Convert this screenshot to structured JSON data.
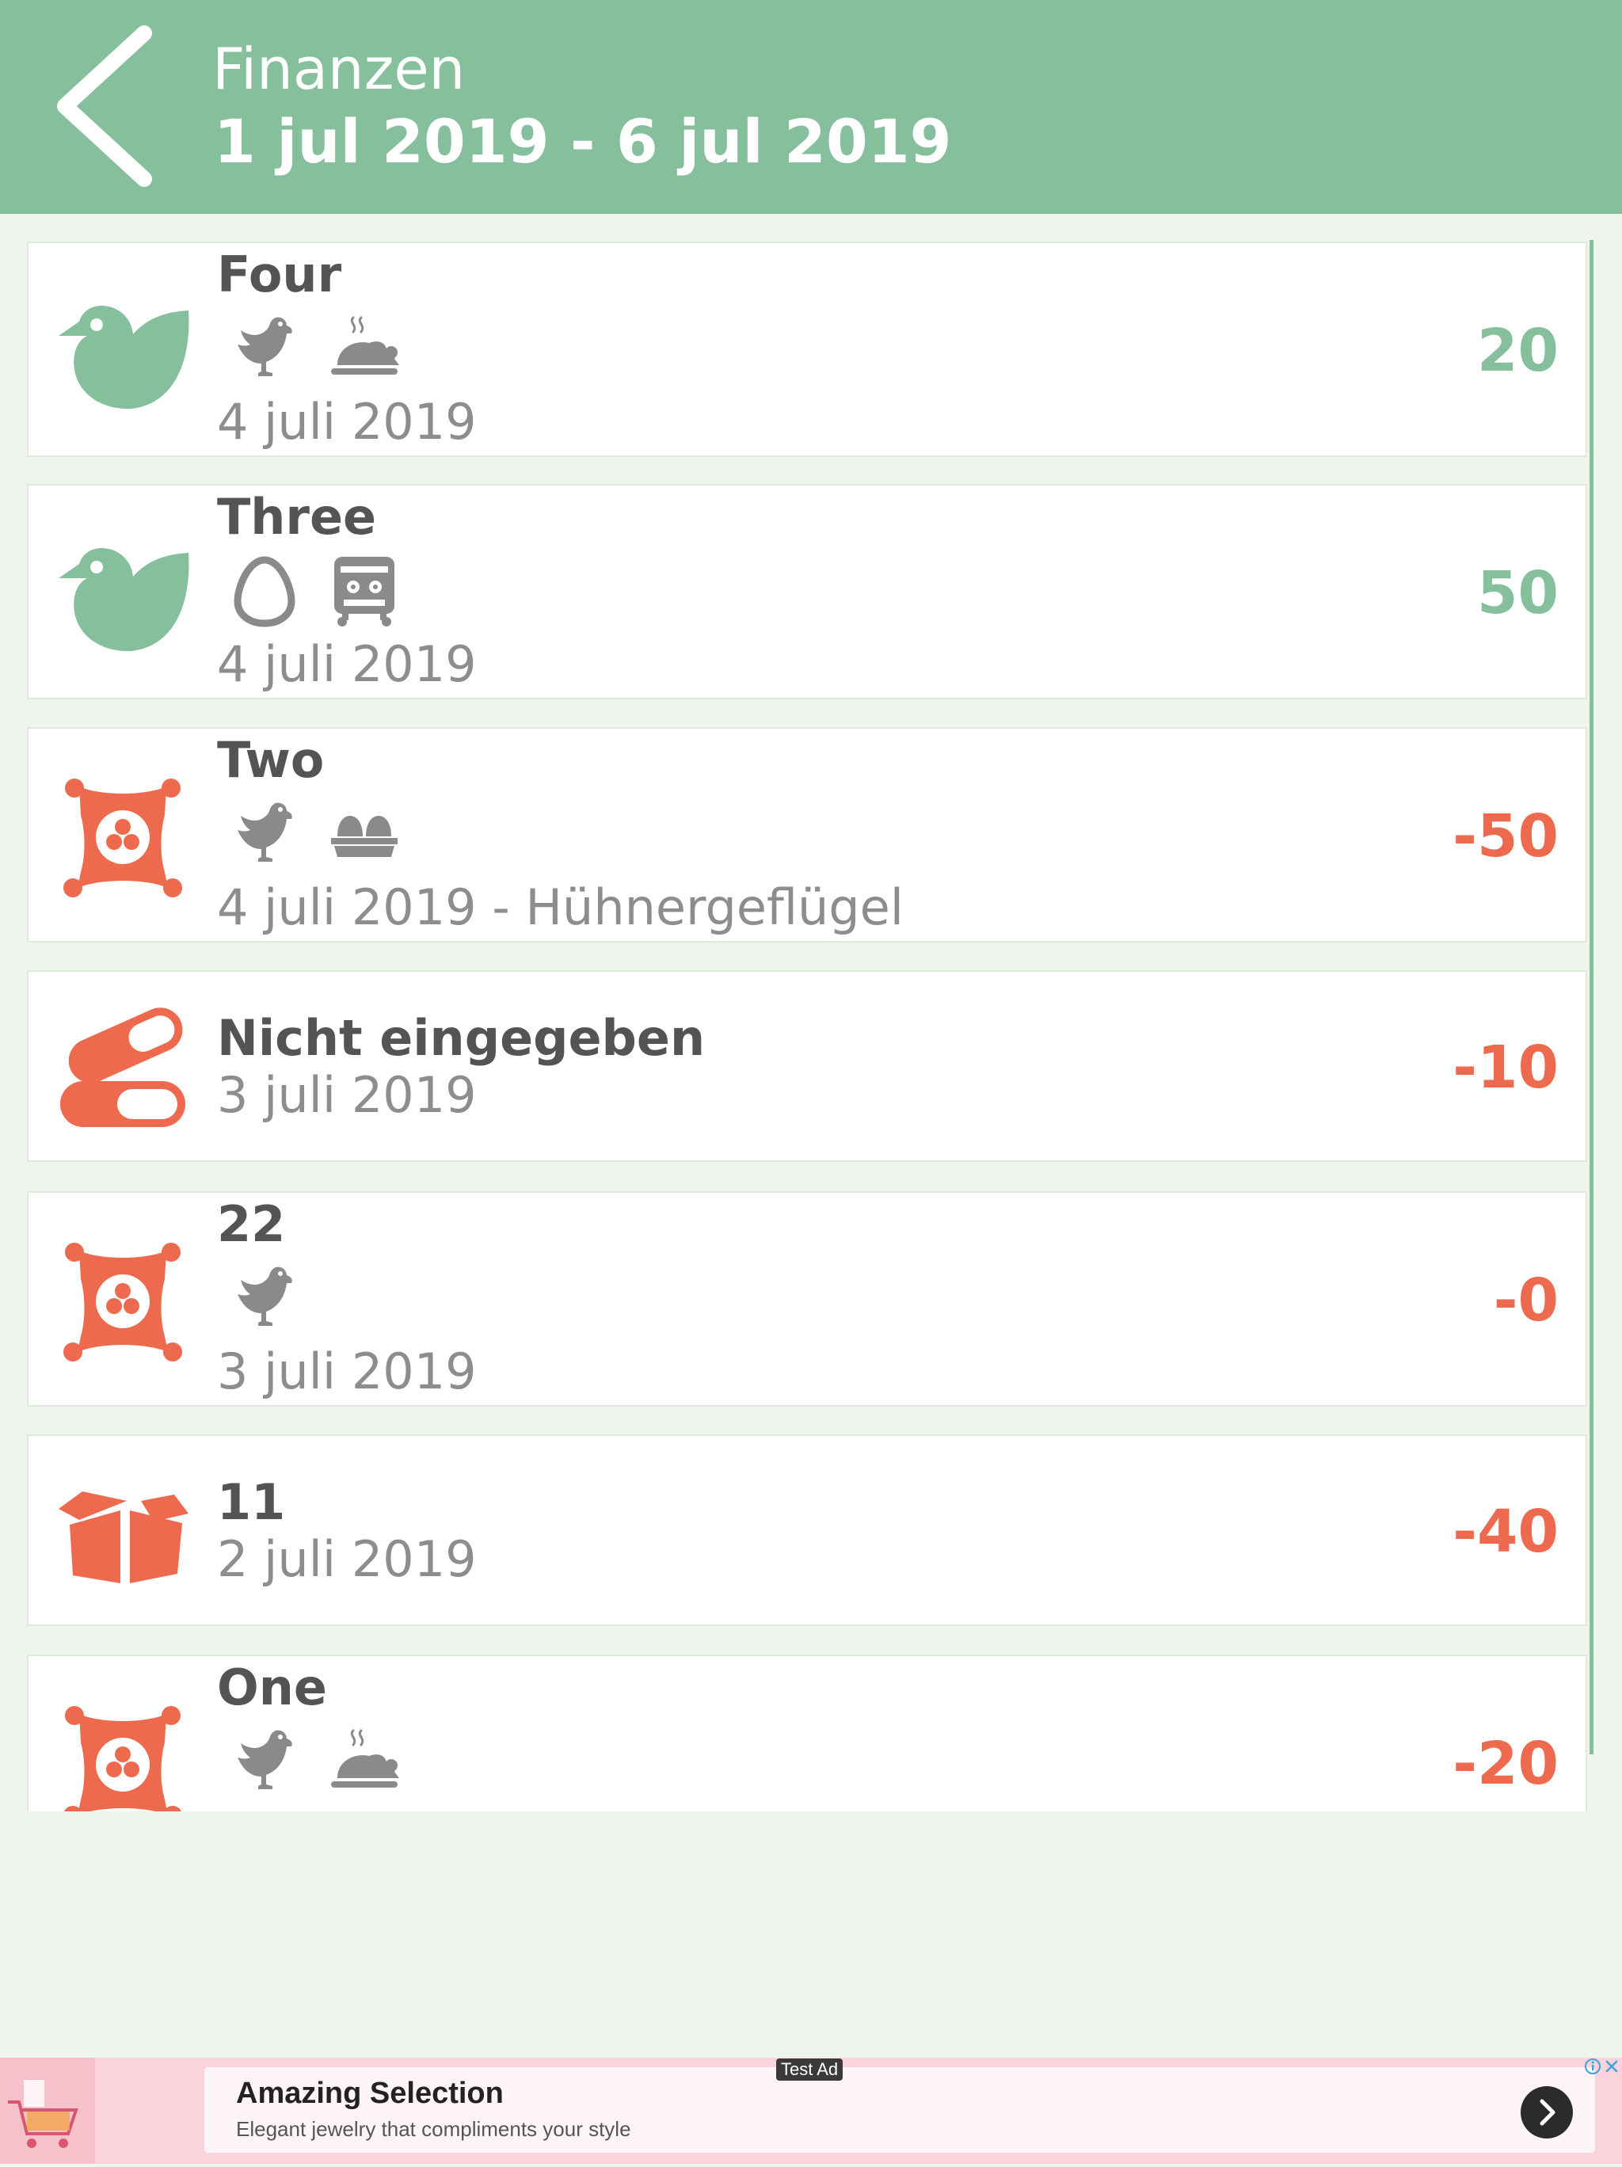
{
  "header": {
    "title": "Finanzen",
    "date_range": "1 jul 2019 - 6 jul 2019",
    "color": "#85bf9c"
  },
  "colors": {
    "income": "#85bf9c",
    "expense": "#ee6a4e",
    "tag": "#8a8a8a",
    "title": "#545454",
    "subtitle": "#8d8d8d"
  },
  "transactions": [
    {
      "title": "Four",
      "subtitle": "4 juli 2019",
      "amount": "20",
      "kind": "income",
      "category_icon": "bird-icon",
      "tags": [
        "chicken-icon",
        "roast-chicken-icon"
      ]
    },
    {
      "title": "Three",
      "subtitle": "4 juli 2019",
      "amount": "50",
      "kind": "income",
      "category_icon": "bird-icon",
      "tags": [
        "egg-icon",
        "coop-icon"
      ]
    },
    {
      "title": "Two",
      "subtitle": "4 juli 2019 - Hühnergeflügel",
      "amount": "-50",
      "kind": "expense",
      "category_icon": "feed-bag-icon",
      "tags": [
        "chicken-icon",
        "egg-carton-icon"
      ]
    },
    {
      "title": "Nicht eingegeben",
      "subtitle": "3 juli 2019",
      "amount": "-10",
      "kind": "expense",
      "category_icon": "pills-icon",
      "tags": []
    },
    {
      "title": "22",
      "subtitle": "3 juli 2019",
      "amount": "-0",
      "kind": "expense",
      "category_icon": "feed-bag-icon",
      "tags": [
        "chicken-icon"
      ]
    },
    {
      "title": "11",
      "subtitle": "2 juli 2019",
      "amount": "-40",
      "kind": "expense",
      "category_icon": "box-icon",
      "tags": []
    },
    {
      "title": "One",
      "subtitle": "",
      "amount": "-20",
      "kind": "expense",
      "category_icon": "feed-bag-icon",
      "tags": [
        "chicken-icon",
        "roast-chicken-icon"
      ]
    }
  ],
  "ad": {
    "badge": "Test Ad",
    "title": "Amazing Selection",
    "description": "Elegant jewelry that compliments your style",
    "icons": [
      "shopping-cart-icon",
      "info-icon",
      "close-icon",
      "chevron-right-icon"
    ]
  }
}
